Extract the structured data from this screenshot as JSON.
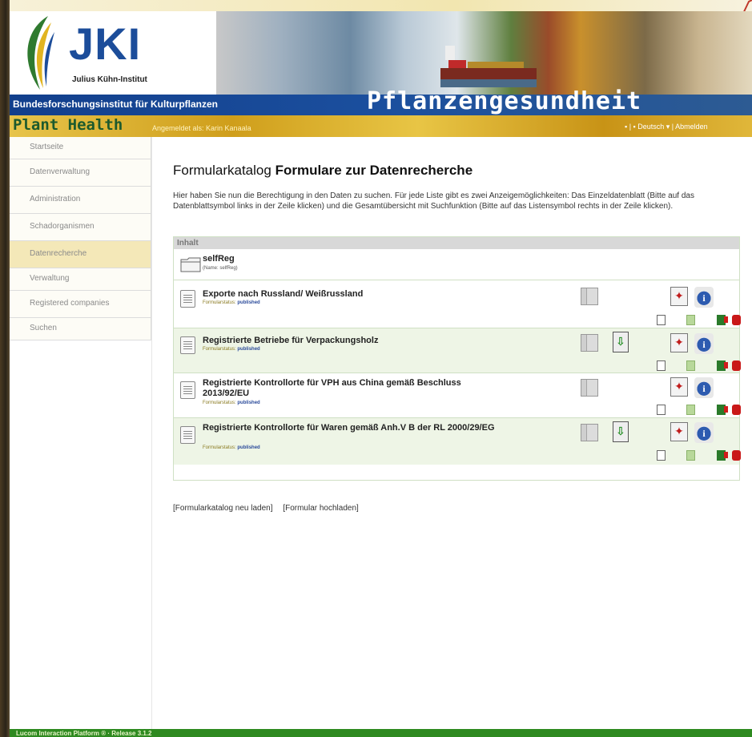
{
  "header": {
    "logo_text": "JKI",
    "logo_subtitle": "Julius Kühn-Institut",
    "institute": "Bundesforschungsinstitut für Kulturpflanzen",
    "section_title": "Pflanzengesundheit",
    "site_name": "Plant Health",
    "logged_in": "Angemeldet als: Karin Kanaala",
    "language": "Deutsch",
    "logout": "Abmelden"
  },
  "sidebar": {
    "items": [
      {
        "label": "Startseite"
      },
      {
        "label": "Datenverwaltung"
      },
      {
        "label": "Administration"
      },
      {
        "label": "Schadorganismen"
      },
      {
        "label": "Datenrecherche"
      },
      {
        "label": "Verwaltung"
      },
      {
        "label": "Registered companies"
      },
      {
        "label": "Suchen"
      }
    ],
    "active_index": 4
  },
  "main": {
    "title_prefix": "Formularkatalog",
    "title_main": "Formulare zur Datenrecherche",
    "intro": "Hier haben Sie nun die Berechtigung in den Daten zu suchen. Für jede Liste gibt es zwei Anzeigemöglichkeiten: Das Einzeldatenblatt (Bitte auf das Datenblattsymbol links in der Zeile klicken) und die Gesamtübersicht mit Suchfunktion (Bitte auf das Listensymbol rechts in der Zeile klicken).",
    "panel_header": "Inhalt",
    "folder": {
      "name": "selfReg",
      "meta": "(Name: selfReg)"
    },
    "status_label": "Formularstatus:",
    "forms": [
      {
        "title": "Exporte nach Russland/ Weißrussland",
        "status": "published"
      },
      {
        "title": "Registrierte Betriebe für Verpackungsholz",
        "status": "published"
      },
      {
        "title": "Registrierte Kontrollorte für VPH aus China gemäß Beschluss 2013/92/EU",
        "status": "published"
      },
      {
        "title": "Registrierte Kontrollorte für Waren gemäß Anh.V B der RL 2000/29/EG",
        "status": "published"
      }
    ],
    "links": {
      "reload": "[Formularkatalog neu laden]",
      "upload": "[Formular hochladen]"
    }
  },
  "footer": {
    "text": "Lucom Interaction Platform ® · Release 3.1.2"
  },
  "colors": {
    "brand_blue": "#1c4d9a",
    "brand_yellow": "#e0b73a",
    "footer_green": "#2e8a20",
    "row_even": "#eef5e6"
  }
}
